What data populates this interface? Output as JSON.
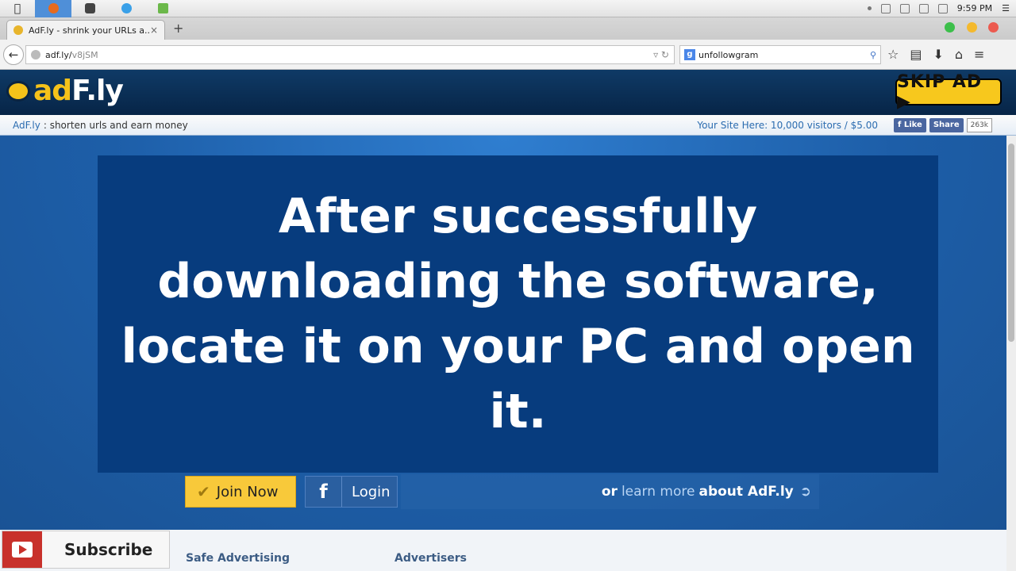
{
  "menubar": {
    "time": "9:59 PM"
  },
  "tab": {
    "title": "AdF.ly - shrink your URLs a...",
    "close": "×",
    "new_tab": "+"
  },
  "navbar": {
    "back": "←",
    "url_host": "adf.ly/",
    "url_path": "v8jSM",
    "search_engine_icon": "g",
    "search_value": "unfollowgram"
  },
  "header": {
    "logo_ad": "ad",
    "logo_fly": "F.ly",
    "skip_label": "SKIP AD ▶"
  },
  "infobar": {
    "brand": "AdF.ly",
    "desc": ": shorten urls and earn money",
    "promo": "Your Site Here: 10,000 visitors / $5.00",
    "like": "f Like",
    "share": "Share",
    "share_count": "263k"
  },
  "ad": {
    "message": "After successfully downloading the software, locate it on your PC and open it."
  },
  "cta": {
    "join": "Join Now",
    "login": "Login",
    "learn_or": "or",
    "learn_link": "learn more",
    "learn_about": "about AdF.ly"
  },
  "footer": {
    "col1": "Safe Advertising",
    "col2": "Advertisers"
  },
  "subscribe": {
    "label": "Subscribe"
  },
  "colors": {
    "brand_yellow": "#f7c81d",
    "ad_bg": "#073c7e",
    "page_blue": "#1e5fa8"
  }
}
